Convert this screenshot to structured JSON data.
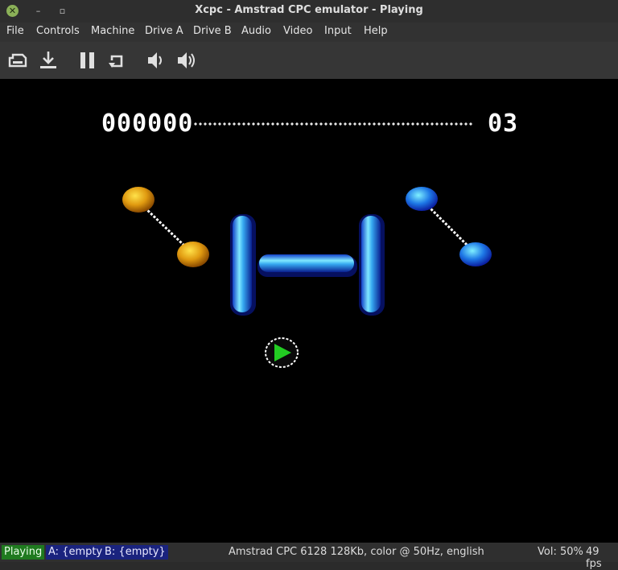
{
  "window": {
    "title": "Xcpc - Amstrad CPC emulator - Playing"
  },
  "menu": [
    {
      "label": "File"
    },
    {
      "label": "Controls"
    },
    {
      "label": "Machine"
    },
    {
      "label": "Drive A"
    },
    {
      "label": "Drive B"
    },
    {
      "label": "Audio"
    },
    {
      "label": "Video"
    },
    {
      "label": "Input"
    },
    {
      "label": "Help"
    }
  ],
  "toolbar": {
    "icons": [
      "snapshot-load-icon",
      "snapshot-save-icon",
      "pause-icon",
      "reset-icon",
      "volume-down-icon",
      "volume-up-icon"
    ]
  },
  "game": {
    "score": "000000",
    "lives": "03"
  },
  "status": {
    "state": "Playing",
    "drive_a": "A: {empty}",
    "drive_b": "B: {empty}",
    "machine": "Amstrad CPC 6128 128Kb, color @ 50Hz, english",
    "volume": "Vol: 50%",
    "fps": "49 fps"
  },
  "colors": {
    "playing_badge": "#1f7a1f",
    "drive_badge": "#1a237e",
    "screen_bg": "#000000"
  }
}
